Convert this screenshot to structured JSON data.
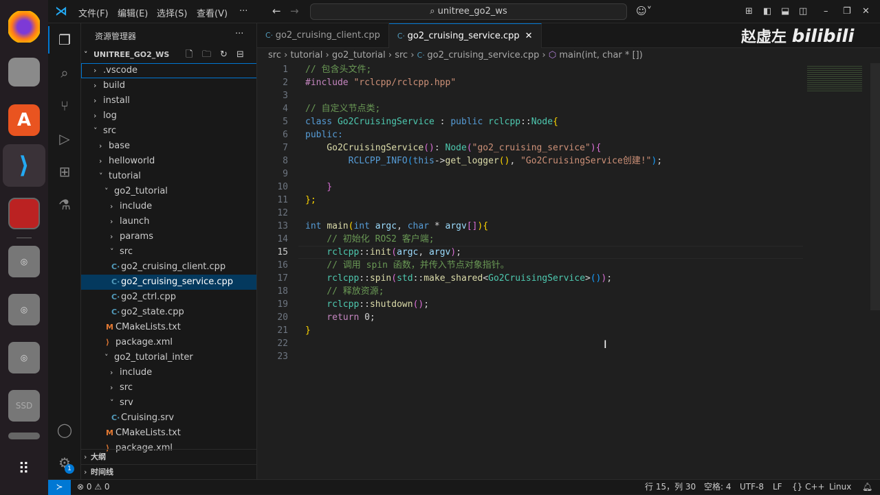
{
  "titlebar": {
    "menus": [
      "文件(F)",
      "编辑(E)",
      "选择(S)",
      "查看(V)",
      "···"
    ],
    "search": "unitree_go2_ws"
  },
  "watermark": {
    "author": "赵虚左",
    "brand": "bilibili"
  },
  "sidebar": {
    "title": "资源管理器",
    "more": "···",
    "root": "UNITREE_GO2_WS",
    "tree": [
      {
        "label": ".vscode",
        "depth": 0,
        "type": "folder",
        "open": false,
        "focus": true
      },
      {
        "label": "build",
        "depth": 0,
        "type": "folder",
        "open": false
      },
      {
        "label": "install",
        "depth": 0,
        "type": "folder",
        "open": false
      },
      {
        "label": "log",
        "depth": 0,
        "type": "folder",
        "open": false
      },
      {
        "label": "src",
        "depth": 0,
        "type": "folder",
        "open": true
      },
      {
        "label": "base",
        "depth": 1,
        "type": "folder",
        "open": false
      },
      {
        "label": "helloworld",
        "depth": 1,
        "type": "folder",
        "open": false
      },
      {
        "label": "tutorial",
        "depth": 1,
        "type": "folder",
        "open": true
      },
      {
        "label": "go2_tutorial",
        "depth": 2,
        "type": "folder",
        "open": true
      },
      {
        "label": "include",
        "depth": 3,
        "type": "folder",
        "open": false
      },
      {
        "label": "launch",
        "depth": 3,
        "type": "folder",
        "open": false
      },
      {
        "label": "params",
        "depth": 3,
        "type": "folder",
        "open": false
      },
      {
        "label": "src",
        "depth": 3,
        "type": "folder",
        "open": true
      },
      {
        "label": "go2_cruising_client.cpp",
        "depth": 4,
        "type": "cpp"
      },
      {
        "label": "go2_cruising_service.cpp",
        "depth": 4,
        "type": "cpp",
        "selected": true
      },
      {
        "label": "go2_ctrl.cpp",
        "depth": 4,
        "type": "cpp"
      },
      {
        "label": "go2_state.cpp",
        "depth": 4,
        "type": "cpp"
      },
      {
        "label": "CMakeLists.txt",
        "depth": 3,
        "type": "cmake"
      },
      {
        "label": "package.xml",
        "depth": 3,
        "type": "xml"
      },
      {
        "label": "go2_tutorial_inter",
        "depth": 2,
        "type": "folder",
        "open": true
      },
      {
        "label": "include",
        "depth": 3,
        "type": "folder",
        "open": false
      },
      {
        "label": "src",
        "depth": 3,
        "type": "folder",
        "open": false
      },
      {
        "label": "srv",
        "depth": 3,
        "type": "folder",
        "open": true
      },
      {
        "label": "Cruising.srv",
        "depth": 4,
        "type": "srv"
      },
      {
        "label": "CMakeLists.txt",
        "depth": 3,
        "type": "cmake"
      },
      {
        "label": "package.xml",
        "depth": 3,
        "type": "xml"
      }
    ],
    "outline": "大纲",
    "timeline": "时间线"
  },
  "tabs": [
    {
      "label": "go2_cruising_client.cpp",
      "active": false
    },
    {
      "label": "go2_cruising_service.cpp",
      "active": true
    }
  ],
  "breadcrumb": [
    "src",
    "tutorial",
    "go2_tutorial",
    "src",
    "go2_cruising_service.cpp",
    "main(int, char * [])"
  ],
  "code": [
    [
      [
        "// 包含头文件;",
        "cm"
      ]
    ],
    [
      [
        "#include ",
        "pp"
      ],
      [
        "\"rclcpp/rclcpp.hpp\"",
        "st"
      ]
    ],
    [],
    [
      [
        "// 自定义节点类;",
        "cm"
      ]
    ],
    [
      [
        "class ",
        "kw"
      ],
      [
        "Go2CruisingService",
        "ty"
      ],
      [
        " : ",
        "tx"
      ],
      [
        "public ",
        "kw"
      ],
      [
        "rclcpp",
        "ty"
      ],
      [
        "::",
        "tx"
      ],
      [
        "Node",
        "ty"
      ],
      [
        "{",
        "br"
      ]
    ],
    [
      [
        "public:",
        "kw"
      ]
    ],
    [
      [
        "    Go2CruisingService",
        "fn"
      ],
      [
        "()",
        "bp"
      ],
      [
        ": ",
        "tx"
      ],
      [
        "Node",
        "ty"
      ],
      [
        "(",
        "bp"
      ],
      [
        "\"go2_cruising_service\"",
        "st"
      ],
      [
        ")",
        "bp"
      ],
      [
        "{",
        "bp"
      ]
    ],
    [
      [
        "        RCLCPP_INFO",
        "kw"
      ],
      [
        "(",
        "bb"
      ],
      [
        "this",
        "kw"
      ],
      [
        "->",
        "tx"
      ],
      [
        "get_logger",
        "fn"
      ],
      [
        "()",
        "br"
      ],
      [
        ", ",
        "tx"
      ],
      [
        "\"Go2CruisingService创建!\"",
        "st"
      ],
      [
        ")",
        "bb"
      ],
      [
        ";",
        "tx"
      ]
    ],
    [],
    [
      [
        "    }",
        "bp"
      ]
    ],
    [
      [
        "};",
        "br"
      ]
    ],
    [],
    [
      [
        "int ",
        "kw"
      ],
      [
        "main",
        "fn"
      ],
      [
        "(",
        "br"
      ],
      [
        "int ",
        "kw"
      ],
      [
        "argc",
        "va"
      ],
      [
        ", ",
        "tx"
      ],
      [
        "char ",
        "kw"
      ],
      [
        "* ",
        "tx"
      ],
      [
        "argv",
        "va"
      ],
      [
        "[]",
        "bp"
      ],
      [
        ")",
        "br"
      ],
      [
        "{",
        "br"
      ]
    ],
    [
      [
        "    // 初始化 ROS2 客户端;",
        "cm"
      ]
    ],
    [
      [
        "    rclcpp",
        "ty"
      ],
      [
        "::",
        "tx"
      ],
      [
        "init",
        "fn"
      ],
      [
        "(",
        "bp"
      ],
      [
        "argc",
        "va"
      ],
      [
        ", ",
        "tx"
      ],
      [
        "argv",
        "va"
      ],
      [
        ")",
        "bp"
      ],
      [
        ";",
        "tx"
      ]
    ],
    [
      [
        "    // 调用 spin 函数，并传入节点对象指针。",
        "cm"
      ]
    ],
    [
      [
        "    rclcpp",
        "ty"
      ],
      [
        "::",
        "tx"
      ],
      [
        "spin",
        "fn"
      ],
      [
        "(",
        "bp"
      ],
      [
        "std",
        "ty"
      ],
      [
        "::",
        "tx"
      ],
      [
        "make_shared",
        "fn"
      ],
      [
        "<",
        "tx"
      ],
      [
        "Go2CruisingService",
        "ty"
      ],
      [
        ">",
        "tx"
      ],
      [
        "()",
        "bb"
      ],
      [
        ")",
        "bp"
      ],
      [
        ";",
        "tx"
      ]
    ],
    [
      [
        "    // 释放资源;",
        "cm"
      ]
    ],
    [
      [
        "    rclcpp",
        "ty"
      ],
      [
        "::",
        "tx"
      ],
      [
        "shutdown",
        "fn"
      ],
      [
        "()",
        "bp"
      ],
      [
        ";",
        "tx"
      ]
    ],
    [
      [
        "    return ",
        "pp"
      ],
      [
        "0",
        "tx"
      ],
      [
        ";",
        "tx"
      ]
    ],
    [
      [
        "}",
        "br"
      ]
    ],
    [],
    []
  ],
  "current_line": 15,
  "status": {
    "errors": "0",
    "warnings": "0",
    "position": "行 15，列 30",
    "spaces": "空格: 4",
    "encoding": "UTF-8",
    "eol": "LF",
    "language": "C++",
    "os": "Linux"
  },
  "dock": {
    "ssd": "SSD",
    "badge": "1"
  }
}
